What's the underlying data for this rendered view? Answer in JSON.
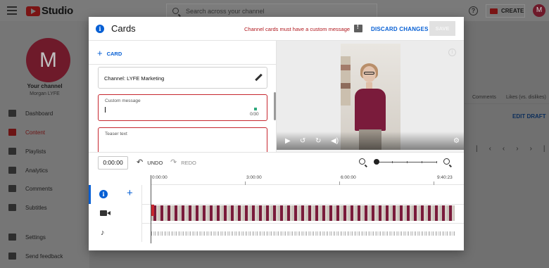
{
  "app": {
    "logo_text": "Studio",
    "search_placeholder": "Search across your channel",
    "create_label": "CREATE",
    "avatar_letter": "M"
  },
  "sidebar": {
    "avatar_letter": "M",
    "your_channel": "Your channel",
    "owner": "Morgan LYFE",
    "items": [
      {
        "label": "Dashboard"
      },
      {
        "label": "Content"
      },
      {
        "label": "Playlists"
      },
      {
        "label": "Analytics"
      },
      {
        "label": "Comments"
      },
      {
        "label": "Subtitles"
      }
    ],
    "footer": [
      {
        "label": "Settings"
      },
      {
        "label": "Send feedback"
      }
    ]
  },
  "background": {
    "col_comments": "Comments",
    "col_likes": "Likes (vs. dislikes)",
    "edit_draft": "EDIT DRAFT"
  },
  "modal": {
    "title": "Cards",
    "error": "Channel cards must have a custom message",
    "discard": "DISCARD CHANGES",
    "save": "SAVE",
    "add_card": "CARD",
    "channel_card": "Channel: LYFE Marketing",
    "custom_message_label": "Custom message",
    "custom_message_value": "",
    "custom_message_count": "0/30",
    "teaser_label": "Teaser text",
    "time_value": "0:00:00",
    "undo": "UNDO",
    "redo": "REDO",
    "ruler": [
      "0:00:00",
      "3:00:00",
      "6:00:00",
      "9:40:23"
    ]
  },
  "icons": {
    "accent": "#065fd4",
    "error": "#c6262e"
  }
}
